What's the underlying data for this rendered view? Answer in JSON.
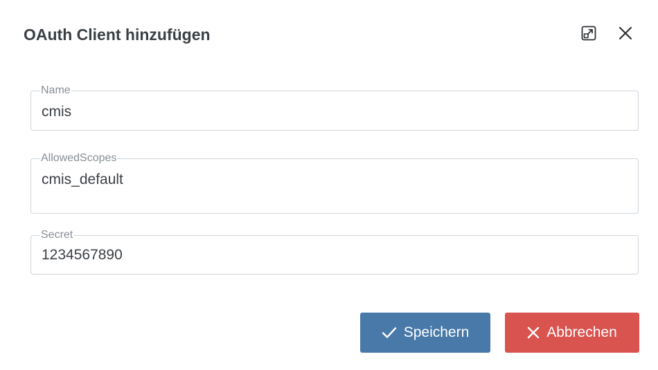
{
  "dialog": {
    "title": "OAuth Client hinzufügen",
    "maximize_icon": "open-in-new-icon",
    "close_icon": "close-icon"
  },
  "form": {
    "name": {
      "label": "Name",
      "value": "cmis"
    },
    "allowed_scopes": {
      "label": "AllowedScopes",
      "value": "cmis_default"
    },
    "secret": {
      "label": "Secret",
      "value": "1234567890"
    }
  },
  "actions": {
    "save_label": "Speichern",
    "save_icon": "check-icon",
    "save_color": "#4879a8",
    "cancel_label": "Abbrechen",
    "cancel_icon": "close-icon",
    "cancel_color": "#d9534f"
  }
}
